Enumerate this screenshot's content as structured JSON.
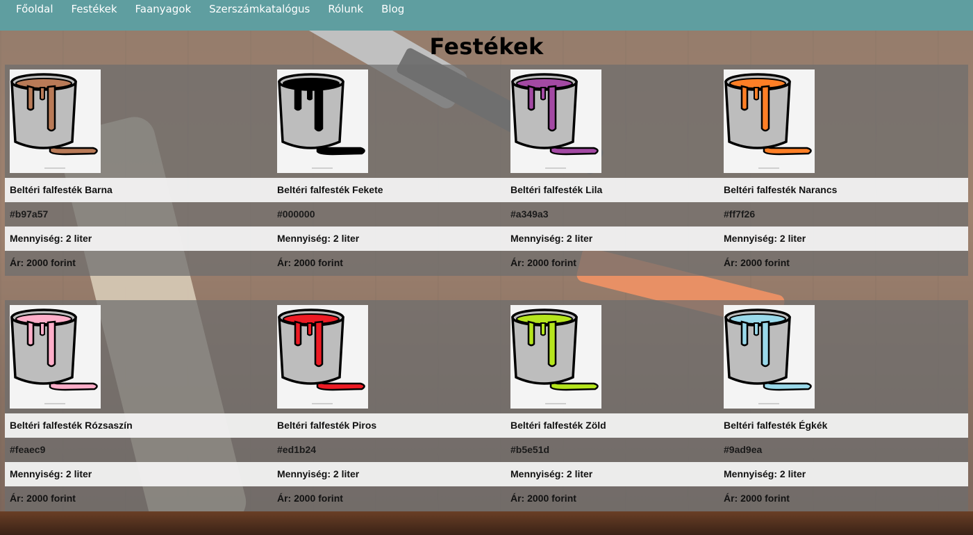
{
  "nav": {
    "items": [
      "Főoldal",
      "Festékek",
      "Faanyagok",
      "Szerszámkatalógus",
      "Rólunk",
      "Blog"
    ]
  },
  "page": {
    "title": "Festékek"
  },
  "products": [
    {
      "name": "Beltéri falfesték Barna",
      "hex": "#b97a57",
      "qty": "Mennyiség: 2 liter",
      "price": "Ár: 2000 forint",
      "color": "#b97a57",
      "icon": "paint-bucket-icon"
    },
    {
      "name": "Beltéri falfesték Fekete",
      "hex": "#000000",
      "qty": "Mennyiség: 2 liter",
      "price": "Ár: 2000 forint",
      "color": "#000000",
      "icon": "paint-bucket-icon"
    },
    {
      "name": "Beltéri falfesték Lila",
      "hex": "#a349a3",
      "qty": "Mennyiség: 2 liter",
      "price": "Ár: 2000 forint",
      "color": "#a349a3",
      "icon": "paint-bucket-icon"
    },
    {
      "name": "Beltéri falfesték Narancs",
      "hex": "#ff7f26",
      "qty": "Mennyiség: 2 liter",
      "price": "Ár: 2000 forint",
      "color": "#ff7f26",
      "icon": "paint-bucket-icon"
    },
    {
      "name": "Beltéri falfesték Rózsaszín",
      "hex": "#feaec9",
      "qty": "Mennyiség: 2 liter",
      "price": "Ár: 2000 forint",
      "color": "#feaec9",
      "icon": "paint-bucket-icon"
    },
    {
      "name": "Beltéri falfesték Piros",
      "hex": "#ed1b24",
      "qty": "Mennyiség: 2 liter",
      "price": "Ár: 2000 forint",
      "color": "#ed1b24",
      "icon": "paint-bucket-icon"
    },
    {
      "name": "Beltéri falfesték Zöld",
      "hex": "#b5e51d",
      "qty": "Mennyiség: 2 liter",
      "price": "Ár: 2000 forint",
      "color": "#b5e51d",
      "icon": "paint-bucket-icon"
    },
    {
      "name": "Beltéri falfesték Égkék",
      "hex": "#9ad9ea",
      "qty": "Mennyiség: 2 liter",
      "price": "Ár: 2000 forint",
      "color": "#9ad9ea",
      "icon": "paint-bucket-icon"
    }
  ],
  "theme": {
    "nav_color": "#5f9ea0"
  }
}
